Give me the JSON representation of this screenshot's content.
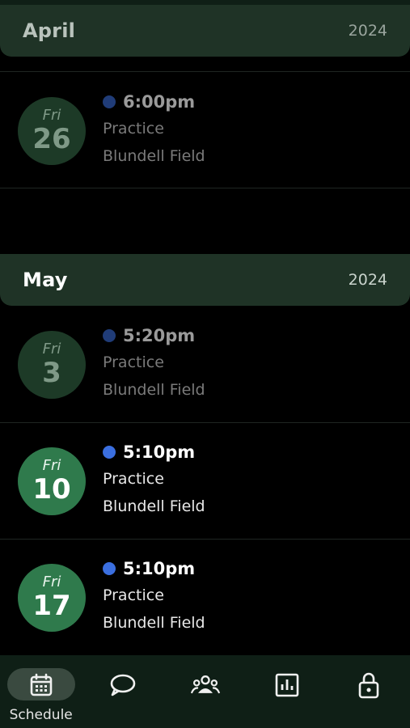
{
  "months": [
    {
      "name": "April",
      "year": "2024"
    },
    {
      "name": "May",
      "year": "2024"
    }
  ],
  "events": [
    {
      "dow": "Fri",
      "day": "26",
      "time": "6:00pm",
      "title": "Practice",
      "location": "Blundell Field",
      "past": true
    },
    {
      "dow": "Fri",
      "day": "3",
      "time": "5:20pm",
      "title": "Practice",
      "location": "Blundell Field",
      "past": true
    },
    {
      "dow": "Fri",
      "day": "10",
      "time": "5:10pm",
      "title": "Practice",
      "location": "Blundell Field",
      "past": false
    },
    {
      "dow": "Fri",
      "day": "17",
      "time": "5:10pm",
      "title": "Practice",
      "location": "Blundell Field",
      "past": false
    }
  ],
  "nav": {
    "items": [
      {
        "label": "Schedule",
        "icon": "calendar-icon",
        "active": true
      },
      {
        "label": "",
        "icon": "chat-icon",
        "active": false
      },
      {
        "label": "",
        "icon": "team-icon",
        "active": false
      },
      {
        "label": "",
        "icon": "stats-icon",
        "active": false
      },
      {
        "label": "",
        "icon": "lock-icon",
        "active": false
      }
    ]
  },
  "colors": {
    "accent_green": "#2f7a4c",
    "header_bg": "#1f3326",
    "nav_bg": "#0f1f16",
    "event_dot": "#3b6fe0"
  }
}
